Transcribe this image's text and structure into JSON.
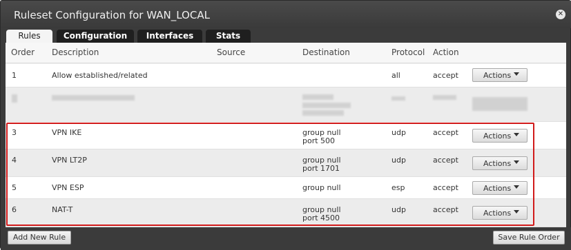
{
  "dialog": {
    "title": "Ruleset Configuration for WAN_LOCAL",
    "close_glyph": "✕"
  },
  "tabs": [
    {
      "label": "Rules",
      "active": true
    },
    {
      "label": "Configuration",
      "active": false
    },
    {
      "label": "Interfaces",
      "active": false
    },
    {
      "label": "Stats",
      "active": false
    }
  ],
  "table": {
    "headers": {
      "order": "Order",
      "description": "Description",
      "source": "Source",
      "destination": "Destination",
      "protocol": "Protocol",
      "action": "Action"
    },
    "rows": [
      {
        "order": "1",
        "description": "Allow established/related",
        "dest_line1": "",
        "dest_line2": "",
        "protocol": "all",
        "action": "accept",
        "button": "Actions"
      },
      {
        "order": "3",
        "description": "VPN IKE",
        "dest_line1": "group null",
        "dest_line2": "port 500",
        "protocol": "udp",
        "action": "accept",
        "button": "Actions"
      },
      {
        "order": "4",
        "description": "VPN LT2P",
        "dest_line1": "group null",
        "dest_line2": "port 1701",
        "protocol": "udp",
        "action": "accept",
        "button": "Actions"
      },
      {
        "order": "5",
        "description": "VPN ESP",
        "dest_line1": "group null",
        "dest_line2": "",
        "protocol": "esp",
        "action": "accept",
        "button": "Actions"
      },
      {
        "order": "6",
        "description": "NAT-T",
        "dest_line1": "group null",
        "dest_line2": "port 4500",
        "protocol": "udp",
        "action": "accept",
        "button": "Actions"
      }
    ]
  },
  "footer": {
    "add_rule": "Add New Rule",
    "save_order": "Save Rule Order"
  },
  "colors": {
    "highlight": "#d11a1a",
    "dialog_bg": "#3b3b3b"
  }
}
